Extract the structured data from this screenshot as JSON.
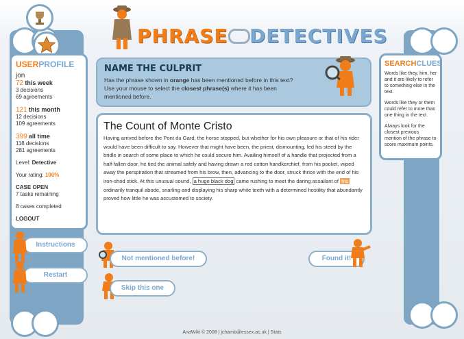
{
  "app": {
    "logo_part1": "PHRASE",
    "logo_part2": "DETECTIVES"
  },
  "profile": {
    "heading_user": "USER",
    "heading_profile": "PROFILE",
    "username": "jon",
    "week_count": "72",
    "week_label": "this week",
    "week_decisions": "3 decisions",
    "week_agreements": "69 agreements",
    "month_count": "121",
    "month_label": "this month",
    "month_decisions": "12 decisions",
    "month_agreements": "109 agreements",
    "all_count": "399",
    "all_label": "all time",
    "all_decisions": "118 decisions",
    "all_agreements": "281 agreements",
    "level_label": "Level:",
    "level_value": "Detective",
    "rating_label": "Your rating:",
    "rating_value": "100%",
    "case_status": "CASE OPEN",
    "tasks_remaining": "7 tasks remaining",
    "cases_completed": "8 cases completed",
    "logout": "LOGOUT"
  },
  "task": {
    "title": "NAME THE CULPRIT",
    "instr_1a": "Has the phrase shown in ",
    "instr_1b": "orange",
    "instr_1c": " has been mentioned before in this text?",
    "instr_2a": "Use your mouse to select the ",
    "instr_2b": "closest phrase(s)",
    "instr_2c": " where it has been",
    "instr_3": "mentioned before."
  },
  "document": {
    "title": "The Count of Monte Cristo",
    "text_before": "Having arrived before the Pont du Gard, the horse stopped, but whether for his own pleasure or that of his rider would have been difficult to say. However that might have been, the priest, dismounting, led his steed by the bridle in search of some place to which he could secure him. Availing himself of a handle that projected from a half-fallen door, he tied the animal safely and having drawn a red cotton handkerchief, from his pocket, wiped away the perspiration that streamed from his brow, then, advancing to the door, struck thrice with the end of his iron-shod stick. At this unusual sound, ",
    "markable": "a huge black dog",
    "text_middle": " came rushing to meet the daring assailant of ",
    "antecedent": "his",
    "text_after": " ordinarily tranquil abode, snarling and displaying his sharp white teeth with a determined hostility that abundantly proved how little he was accustomed to society."
  },
  "clues": {
    "heading_search": "SEARCH",
    "heading_clues": "CLUES",
    "p1": "Words like they, him, her and it are likely to refer to something else in the text.",
    "p2": "Words like they or them could refer to more than one thing in the text.",
    "p3": "Always look for the closest previous mention of the phrase to score maximum points."
  },
  "buttons": {
    "instructions": "Instructions",
    "restart": "Restart",
    "not_mentioned": "Not mentioned before!",
    "found_it": "Found it!",
    "skip": "Skip this one"
  },
  "footer": {
    "text": "AnaWiki © 2008 | jchamb@essex.ac.uk | Stats"
  },
  "colors": {
    "accent_orange": "#f07d1a",
    "accent_blue": "#7ba7cf",
    "panel_blue": "#aac9de"
  },
  "icons": [
    "detective-figure-icon",
    "trophy-icon",
    "star-icon",
    "magnifier-figure-icon",
    "pointing-figure-icon"
  ]
}
